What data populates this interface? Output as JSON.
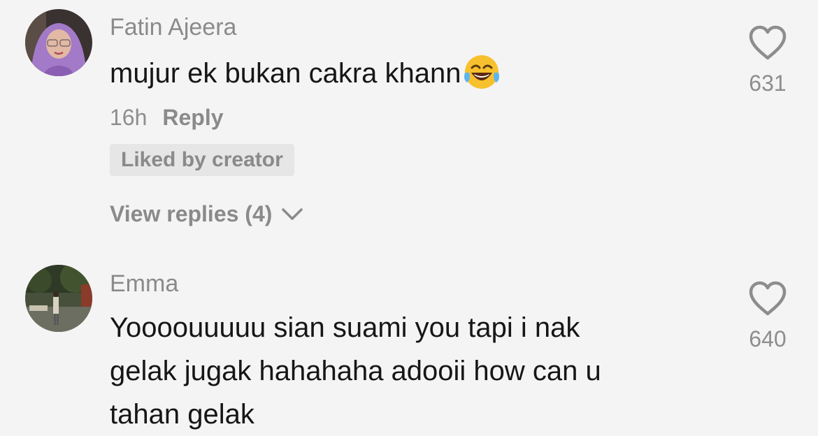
{
  "comments": [
    {
      "username": "Fatin Ajeera",
      "text": "mujur ek bukan cakra khann",
      "emoji": "face-with-tears-of-joy-icon",
      "time": "16h",
      "reply_label": "Reply",
      "badge": "Liked by creator",
      "view_replies": "View replies (4)",
      "likes": "631",
      "avatar": "avatar-woman-purple-hijab"
    },
    {
      "username": "Emma",
      "text_lines": [
        "Yoooouuuuu sian suami you tapi i nak",
        "gelak jugak hahahaha adooii how can u",
        "tahan gelak"
      ],
      "likes": "640",
      "avatar": "avatar-outdoor-photo"
    }
  ],
  "colors": {
    "background": "#f5f4f4",
    "secondary_text": "#8a8a8a",
    "primary_text": "#161616",
    "badge_bg": "#e7e6e6"
  }
}
